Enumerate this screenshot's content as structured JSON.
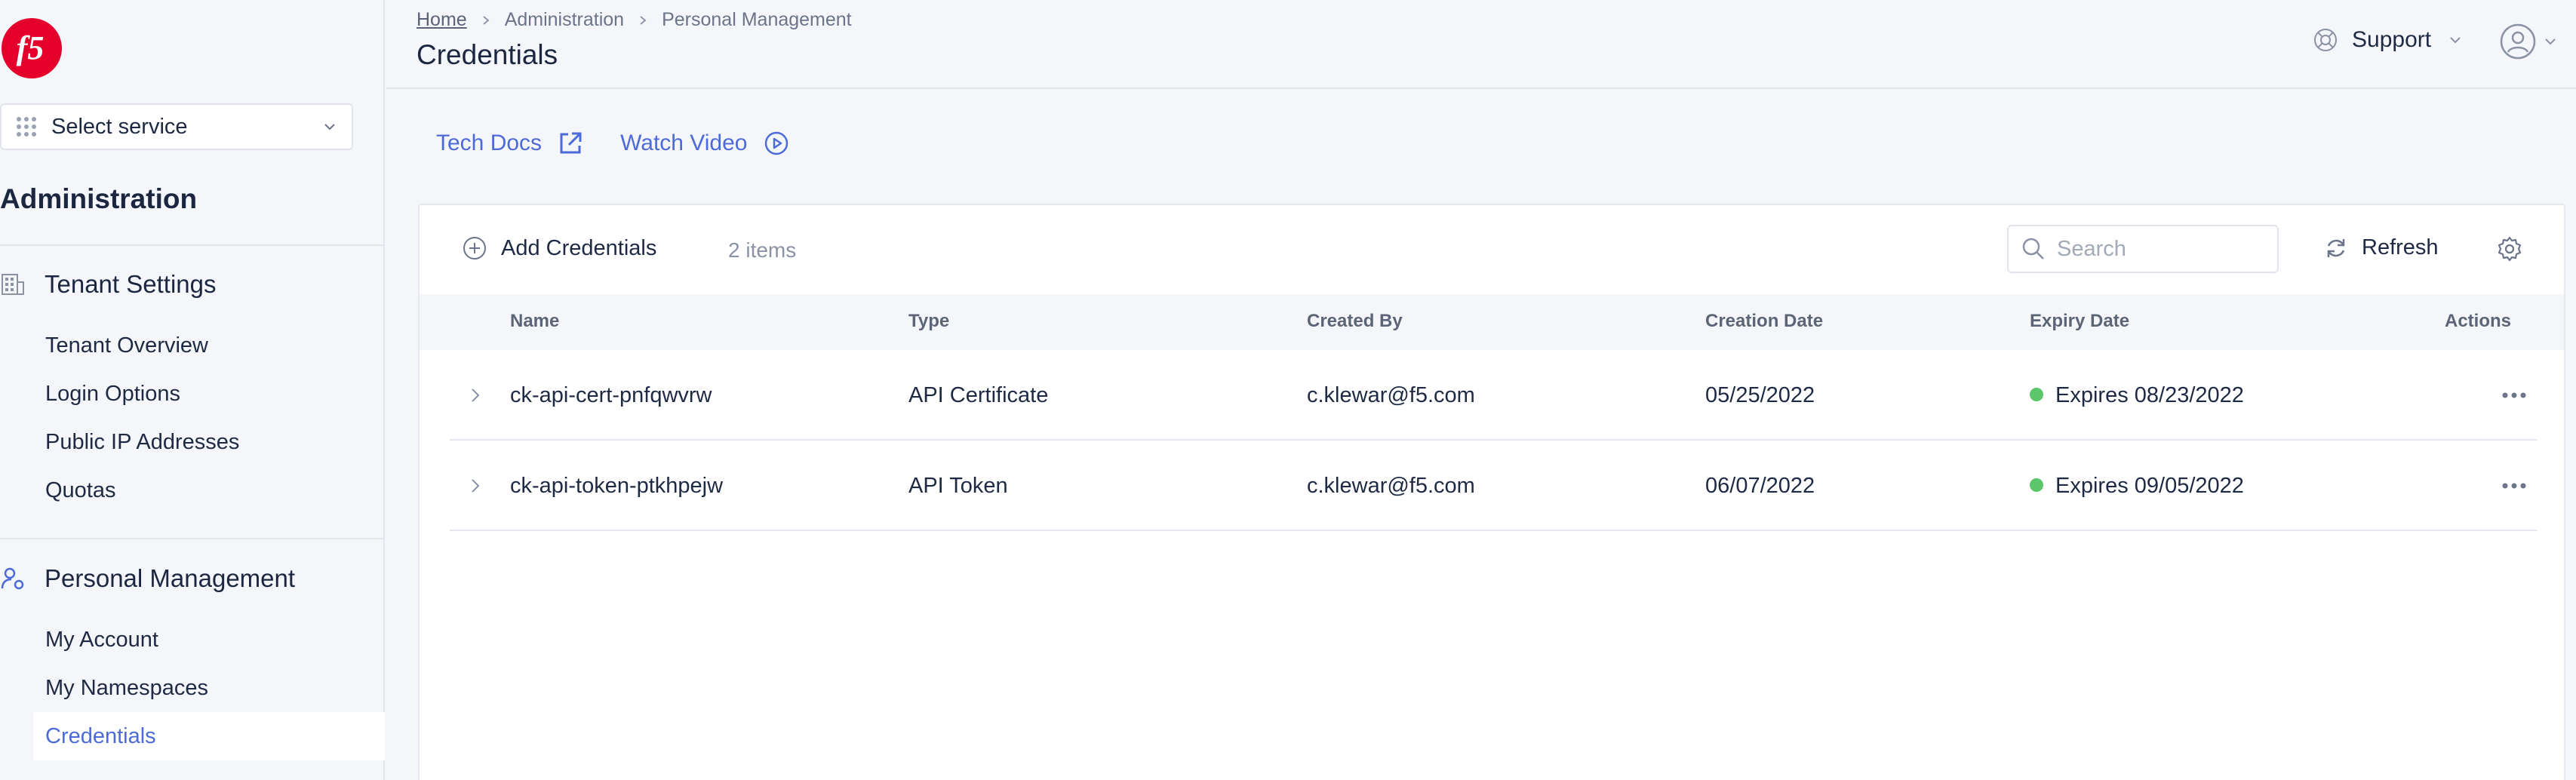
{
  "sidebar": {
    "select_service": "Select service",
    "heading": "Administration",
    "sections": [
      {
        "title": "Tenant Settings",
        "icon": "building-icon",
        "items": [
          "Tenant Overview",
          "Login Options",
          "Public IP Addresses",
          "Quotas"
        ]
      },
      {
        "title": "Personal Management",
        "icon": "user-settings-icon",
        "items": [
          "My Account",
          "My Namespaces",
          "Credentials"
        ]
      }
    ],
    "active_item": "Credentials"
  },
  "header": {
    "breadcrumb": [
      "Home",
      "Administration",
      "Personal Management"
    ],
    "title": "Credentials",
    "support_label": "Support"
  },
  "doc_links": {
    "tech_docs": "Tech Docs",
    "watch_video": "Watch Video"
  },
  "toolbar": {
    "add_label": "Add Credentials",
    "item_count": "2 items",
    "search_placeholder": "Search",
    "refresh_label": "Refresh"
  },
  "table": {
    "columns": [
      "Name",
      "Type",
      "Created By",
      "Creation Date",
      "Expiry Date",
      "Actions"
    ],
    "rows": [
      {
        "name": "ck-api-cert-pnfqwvrw",
        "type": "API Certificate",
        "created_by": "c.klewar@f5.com",
        "creation_date": "05/25/2022",
        "expiry": "Expires 08/23/2022",
        "status_color": "#5cc76a"
      },
      {
        "name": "ck-api-token-ptkhpejw",
        "type": "API Token",
        "created_by": "c.klewar@f5.com",
        "creation_date": "06/07/2022",
        "expiry": "Expires 09/05/2022",
        "status_color": "#5cc76a"
      }
    ]
  },
  "colors": {
    "accent": "#4d6bd8",
    "brand_red": "#e4002b",
    "status_ok": "#5cc76a"
  }
}
